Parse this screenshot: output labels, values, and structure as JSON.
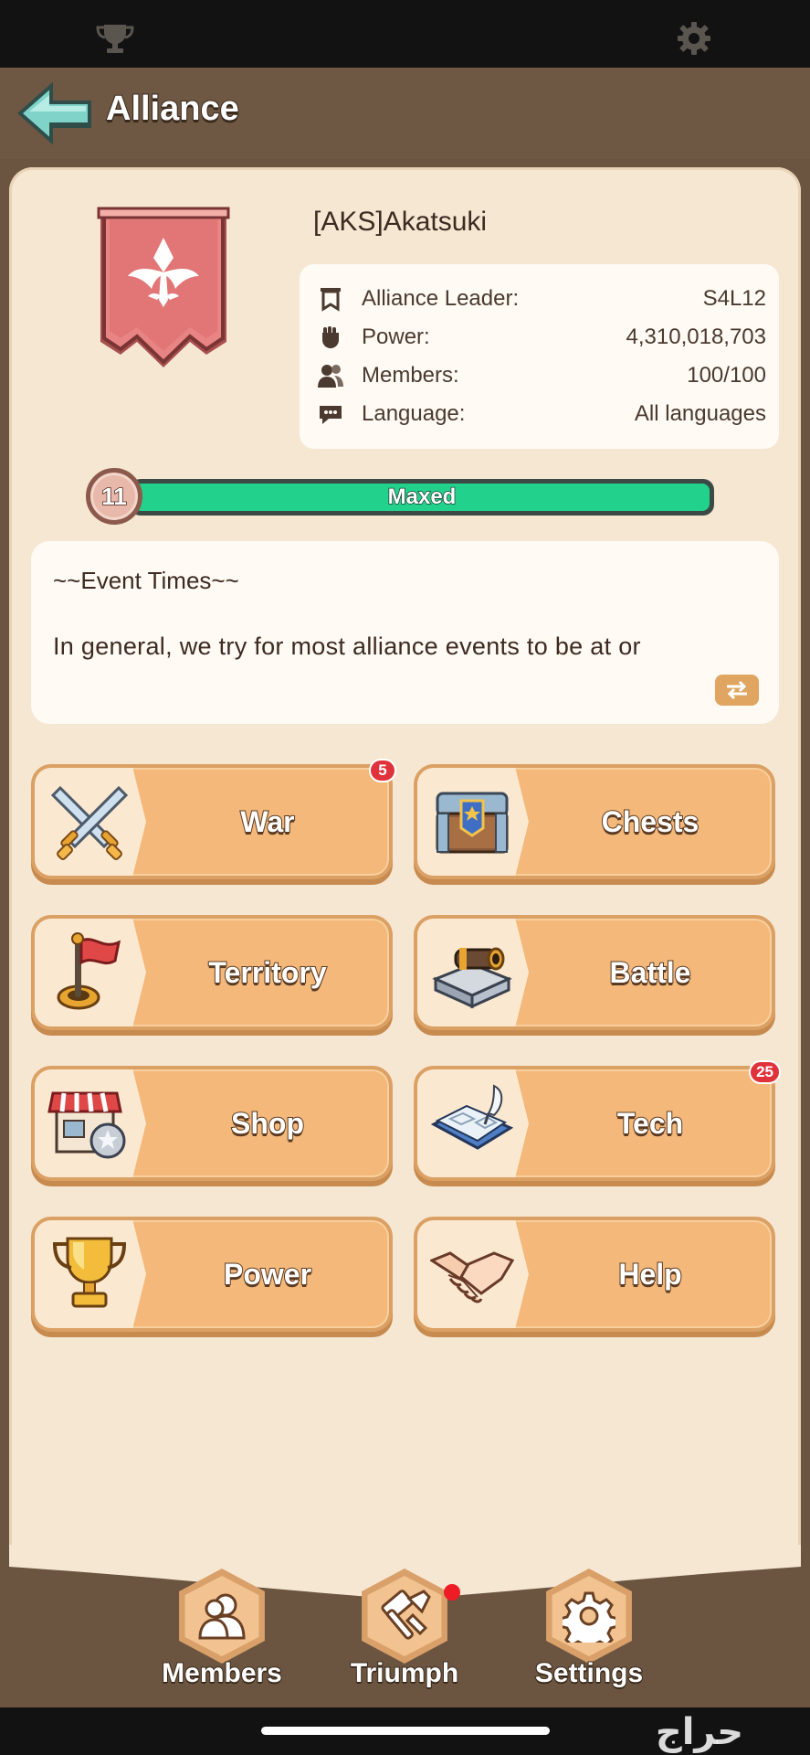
{
  "header": {
    "title": "Alliance"
  },
  "alliance": {
    "name": "[AKS]Akatsuki",
    "info": [
      {
        "label": "Alliance Leader:",
        "value": "S4L12",
        "icon": "banner-icon"
      },
      {
        "label": "Power:",
        "value": "4,310,018,703",
        "icon": "fist-icon"
      },
      {
        "label": "Members:",
        "value": "100/100",
        "icon": "members-icon"
      },
      {
        "label": "Language:",
        "value": "All languages",
        "icon": "chat-icon"
      }
    ],
    "level": "11",
    "level_status": "Maxed",
    "level_progress": 1.0
  },
  "announcement": {
    "title": "~~Event Times~~",
    "body": "In general, we try for most alliance events to be at or"
  },
  "menu": {
    "war": {
      "label": "War",
      "badge": "5"
    },
    "chests": {
      "label": "Chests"
    },
    "territory": {
      "label": "Territory"
    },
    "battle": {
      "label": "Battle"
    },
    "shop": {
      "label": "Shop"
    },
    "tech": {
      "label": "Tech",
      "badge": "25"
    },
    "power": {
      "label": "Power"
    },
    "help": {
      "label": "Help"
    }
  },
  "bottom_nav": {
    "members": "Members",
    "triumph": "Triumph",
    "settings": "Settings"
  },
  "watermark": "حراج",
  "colors": {
    "progress_fill": "#22d28c",
    "button": "#f3b87a",
    "panel": "#f6e7d3",
    "header_bg": "#6e5743",
    "badge": "#e0323a"
  }
}
